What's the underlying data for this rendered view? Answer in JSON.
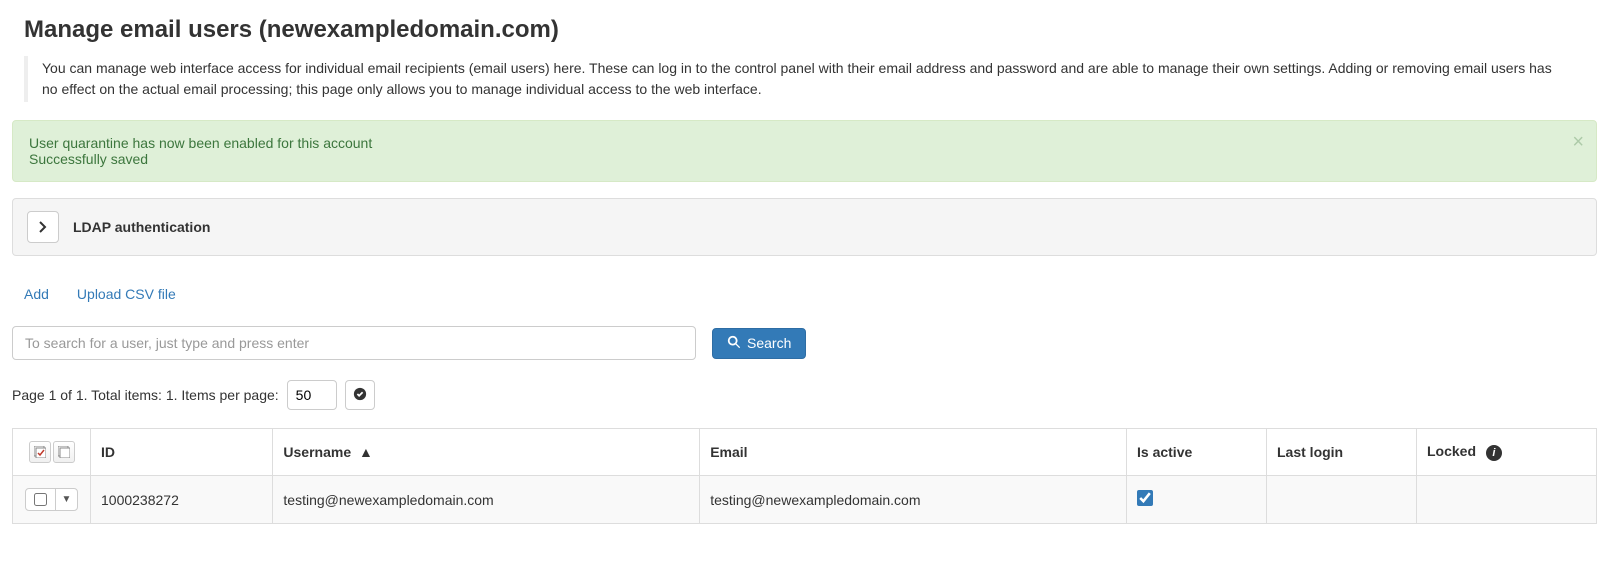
{
  "page_title": "Manage email users (newexampledomain.com)",
  "description": "You can manage web interface access for individual email recipients (email users) here. These can log in to the control panel with their email address and password and are able to manage their own settings. Adding or removing email users has no effect on the actual email processing; this page only allows you to manage individual access to the web interface.",
  "alert": {
    "line1": "User quarantine has now been enabled for this account",
    "line2": "Successfully saved"
  },
  "panel": {
    "title": "LDAP authentication"
  },
  "actions": {
    "add_label": "Add",
    "upload_label": "Upload CSV file"
  },
  "search": {
    "placeholder": "To search for a user, just type and press enter",
    "button_label": "Search"
  },
  "pagination": {
    "text_prefix": "Page 1 of 1. Total items: 1. Items per page:",
    "items_per_page": "50"
  },
  "table": {
    "headers": {
      "id": "ID",
      "username": "Username",
      "email": "Email",
      "is_active": "Is active",
      "last_login": "Last login",
      "locked": "Locked"
    },
    "sort_indicator": "▲",
    "rows": [
      {
        "id": "1000238272",
        "username": "testing@newexampledomain.com",
        "email": "testing@newexampledomain.com",
        "is_active": true,
        "last_login": "",
        "locked": ""
      }
    ]
  }
}
